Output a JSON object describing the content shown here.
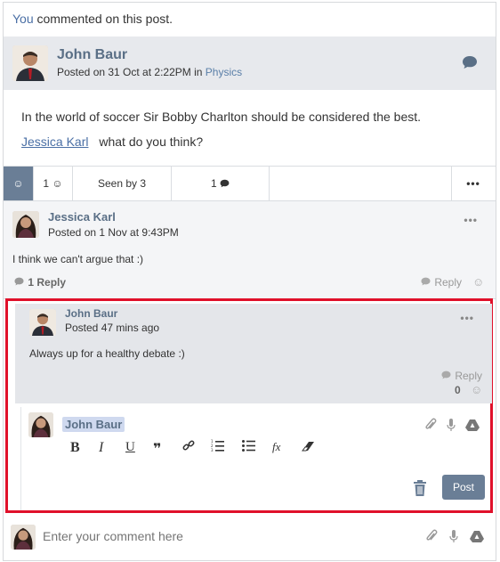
{
  "notice": {
    "you": "You",
    "rest": " commented on this post."
  },
  "post": {
    "author": "John Baur",
    "meta_prefix": "Posted on 31 Oct at 2:22PM",
    "meta_in": " in ",
    "category": "Physics",
    "body": "In the world of soccer Sir Bobby Charlton should be considered the best.",
    "mention": "Jessica Karl",
    "body2": "what do you think?",
    "icons": {
      "comment": "comment-bubble-icon"
    }
  },
  "actions": {
    "smile": "☺",
    "likes": "1 ☺",
    "seen": "Seen by 3",
    "comments_count": "1",
    "more": "•••"
  },
  "comment1": {
    "author": "Jessica Karl",
    "meta": "Posted on 1 Nov at 9:43PM",
    "text": "I think we can't argue that :)",
    "reply_count": "1",
    "reply_count_label": "Reply",
    "reply": "Reply",
    "smile": "☺",
    "more": "•••"
  },
  "comment2": {
    "author": "John Baur",
    "meta": "Posted 47 mins ago",
    "text": "Always up for a healthy debate :)",
    "reply": "Reply",
    "count": "0",
    "smile": "☺",
    "more": "•••"
  },
  "editor": {
    "mention": "John Baur",
    "toolbar": [
      "B",
      "I",
      "U",
      "❞",
      "🔗",
      "ol",
      "ul",
      "fx",
      "eraser"
    ],
    "post_label": "Post"
  },
  "footer": {
    "placeholder": "Enter your comment here"
  },
  "colors": {
    "accent": "#6a7e96",
    "highlight_border": "#e0102a",
    "name": "#5a6f86"
  }
}
